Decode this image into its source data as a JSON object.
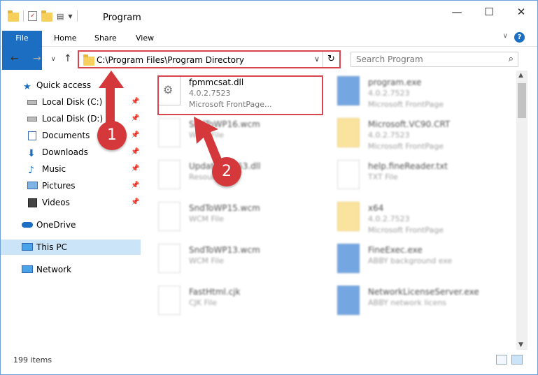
{
  "window": {
    "title": "Program",
    "min": "—",
    "max": "☐",
    "close": "✕"
  },
  "ribbon": {
    "tabs": [
      "File",
      "Home",
      "Share",
      "View"
    ],
    "expand": "∨",
    "help": "?"
  },
  "address": {
    "path": "C:\\Program Files\\Program Directory",
    "dropdown": "∨",
    "refresh": "↻"
  },
  "nav_buttons": {
    "back": "←",
    "forward": "→",
    "recent": "∨",
    "up": "↑"
  },
  "search": {
    "placeholder": "Search Program",
    "icon": "⌕"
  },
  "sidebar": {
    "items": [
      {
        "label": "Quick access",
        "icon": "star-icon"
      },
      {
        "label": "Local Disk (C:)",
        "icon": "drive-icon",
        "pinned": true
      },
      {
        "label": "Local Disk (D:)",
        "icon": "drive-icon",
        "pinned": true
      },
      {
        "label": "Documents",
        "icon": "documents-icon",
        "pinned": true
      },
      {
        "label": "Downloads",
        "icon": "download-icon",
        "pinned": true
      },
      {
        "label": "Music",
        "icon": "music-icon",
        "pinned": true
      },
      {
        "label": "Pictures",
        "icon": "pictures-icon",
        "pinned": true
      },
      {
        "label": "Videos",
        "icon": "videos-icon",
        "pinned": true
      },
      {
        "label": "OneDrive",
        "icon": "onedrive-icon"
      },
      {
        "label": "This PC",
        "icon": "computer-icon",
        "selected": true
      },
      {
        "label": "Network",
        "icon": "network-icon"
      }
    ],
    "pin_glyph": "📌"
  },
  "files": [
    {
      "name": "fpmmcsat.dll",
      "line1": "4.0.2.7523",
      "line2": "Microsoft FrontPage...",
      "type": "dll"
    },
    {
      "name": "program.exe",
      "line1": "4.0.2.7523",
      "line2": "Microsoft FrontPage",
      "type": "exe"
    },
    {
      "name": "SndToWP16.wcm",
      "line1": "WCM File",
      "line2": "",
      "type": "doc"
    },
    {
      "name": "Microsoft.VC90.CRT",
      "line1": "4.0.2.7523",
      "line2": "Microsoft FrontPage",
      "type": "folder"
    },
    {
      "name": "Update.Rec63.dll",
      "line1": "Resource",
      "line2": "",
      "type": "dll"
    },
    {
      "name": "help.fineReader.txt",
      "line1": "TXT File",
      "line2": "",
      "type": "doc"
    },
    {
      "name": "SndToWP15.wcm",
      "line1": "WCM File",
      "line2": "",
      "type": "doc"
    },
    {
      "name": "x64",
      "line1": "4.0.2.7523",
      "line2": "Microsoft FrontPage",
      "type": "folder"
    },
    {
      "name": "SndToWP13.wcm",
      "line1": "WCM File",
      "line2": "",
      "type": "doc"
    },
    {
      "name": "FineExec.exe",
      "line1": "ABBY background exe",
      "line2": "",
      "type": "exe"
    },
    {
      "name": "FastHtml.cjk",
      "line1": "CJK File",
      "line2": "",
      "type": "doc"
    },
    {
      "name": "NetworkLicenseServer.exe",
      "line1": "ABBY network licens",
      "line2": "",
      "type": "exe"
    }
  ],
  "status": {
    "count": "199 items"
  },
  "annotations": {
    "badge1": "1",
    "badge2": "2"
  },
  "colors": {
    "accent": "#1c6ec2",
    "highlight": "#d9454f",
    "selected": "#cce4f7"
  }
}
